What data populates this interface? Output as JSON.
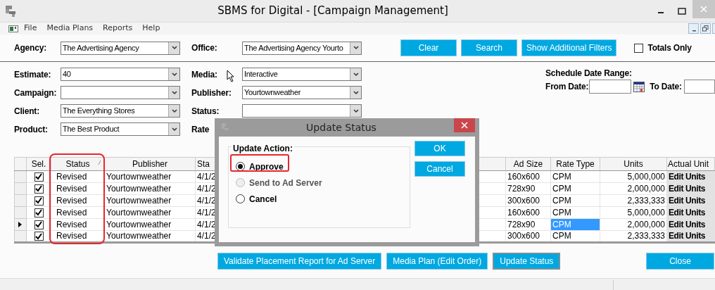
{
  "window": {
    "title": "SBMS for Digital - [Campaign Management]"
  },
  "menu": [
    "File",
    "Media Plans",
    "Reports",
    "Help"
  ],
  "top_filters": [
    {
      "label": "Agency:",
      "value": "The Advertising Agency"
    },
    {
      "label": "Office:",
      "value": "The Advertising Agency Yourto"
    }
  ],
  "top_buttons": [
    "Clear",
    "Search",
    "Show Additional Filters"
  ],
  "totals_only": {
    "label": "Totals Only",
    "checked": false
  },
  "filters_left": [
    {
      "label": "Estimate:",
      "value": "40"
    },
    {
      "label": "Campaign:"
    },
    {
      "label": "Client:",
      "value": "The Everything Stores"
    },
    {
      "label": "Product:",
      "value": "The Best Product"
    }
  ],
  "filters_right": [
    {
      "label": "Media:",
      "kind": "combo",
      "value": "Interactive"
    },
    {
      "label": "Publisher:",
      "kind": "combo",
      "value": "Yourtownweather"
    },
    {
      "label": "Status:",
      "kind": "combo"
    },
    {
      "label": "Rate",
      "kind": "label"
    }
  ],
  "schedule": {
    "title": "Schedule Date Range:",
    "from_label": "From Date:",
    "to_label": "To Date:"
  },
  "table": {
    "columns": [
      {
        "label": "Sel.",
        "sorted": false
      },
      {
        "label": "Status",
        "sorted": true
      },
      {
        "label": "Publisher",
        "sorted": false
      },
      {
        "label": "Sta",
        "sorted": false
      },
      {
        "label": "Ad Size",
        "sorted": false
      },
      {
        "label": "Rate Type",
        "sorted": false
      },
      {
        "label": "Units",
        "sorted": false
      },
      {
        "label": "Actual Unit",
        "sorted": false
      }
    ],
    "rows": [
      {
        "current": false,
        "checked": true,
        "status": "Revised",
        "publisher": "Yourtownweather",
        "column_4": "4/1/2",
        "ad_size": "160x600",
        "rate_type": "CPM",
        "rate_type_selected": false,
        "units": "5,000,000",
        "actual_units": "Edit Units"
      },
      {
        "current": false,
        "checked": true,
        "status": "Revised",
        "publisher": "Yourtownweather",
        "column_4": "4/1/2",
        "ad_size": "728x90",
        "rate_type": "CPM",
        "rate_type_selected": false,
        "units": "2,000,000",
        "actual_units": "Edit Units"
      },
      {
        "current": false,
        "checked": true,
        "status": "Revised",
        "publisher": "Yourtownweather",
        "column_4": "4/1/2",
        "ad_size": "300x600",
        "rate_type": "CPM",
        "rate_type_selected": false,
        "units": "2,333,333",
        "actual_units": "Edit Units"
      },
      {
        "current": false,
        "checked": true,
        "status": "Revised",
        "publisher": "Yourtownweather",
        "column_4": "4/1/2",
        "ad_size": "160x600",
        "rate_type": "CPM",
        "rate_type_selected": false,
        "units": "5,000,000",
        "actual_units": "Edit Units"
      },
      {
        "current": true,
        "checked": true,
        "status": "Revised",
        "publisher": "Yourtownweather",
        "column_4": "4/1/2",
        "ad_size": "728x90",
        "rate_type": "CPM",
        "rate_type_selected": true,
        "units": "2,000,000",
        "actual_units": "Edit Units"
      },
      {
        "current": false,
        "checked": true,
        "status": "Revised",
        "publisher": "Yourtownweather",
        "column_4": "4/1/2",
        "ad_size": "300x600",
        "rate_type": "CPM",
        "rate_type_selected": false,
        "units": "2,333,333",
        "actual_units": "Edit Units"
      }
    ]
  },
  "dialog": {
    "title": "Update Status",
    "group_title": "Update Action:",
    "options": [
      {
        "label": "Approve",
        "selected": true,
        "disabled": false
      },
      {
        "label": "Send to Ad Server",
        "selected": false,
        "disabled": true
      },
      {
        "label": "Cancel",
        "selected": false,
        "disabled": false
      }
    ],
    "buttons": [
      "OK",
      "Cancel"
    ]
  },
  "bottom_buttons": [
    {
      "label": "Validate Placement Report for Ad Server",
      "focused": false
    },
    {
      "label": "Media Plan (Edit Order)",
      "focused": false
    },
    {
      "label": "Update Status",
      "focused": true
    },
    {
      "label": "Close",
      "focused": false
    }
  ]
}
